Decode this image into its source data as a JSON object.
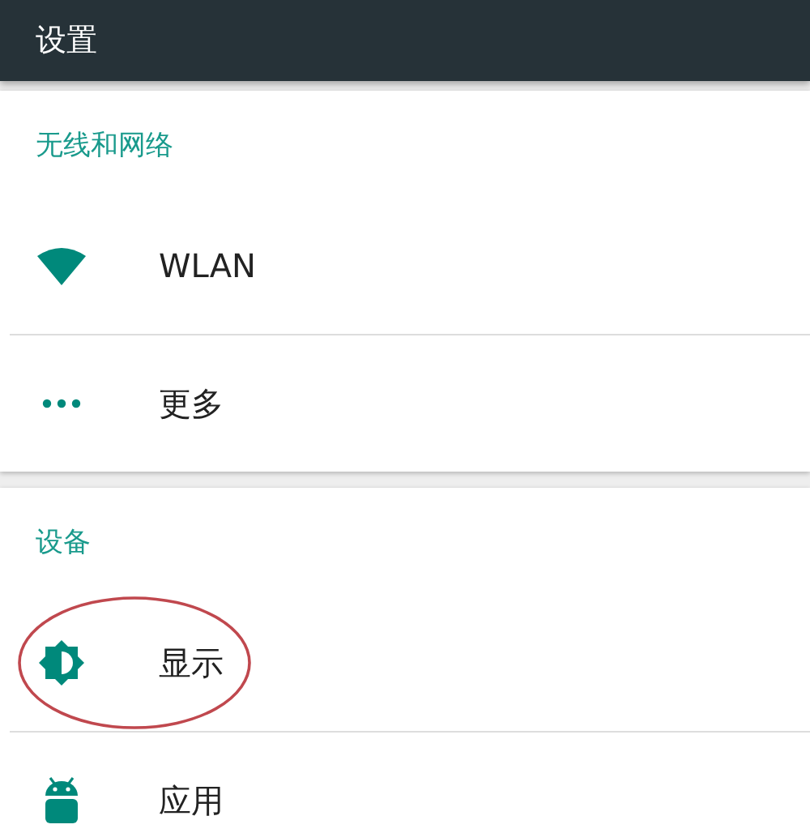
{
  "app_bar": {
    "title": "设置"
  },
  "sections": [
    {
      "header": "无线和网络",
      "items": [
        {
          "label": "WLAN",
          "kind": "wifi",
          "highlighted": false
        },
        {
          "label": "更多",
          "kind": "more",
          "highlighted": false
        }
      ]
    },
    {
      "header": "设备",
      "items": [
        {
          "label": "显示",
          "kind": "brightness",
          "highlighted": true
        },
        {
          "label": "应用",
          "kind": "android",
          "highlighted": false
        }
      ]
    }
  ]
}
